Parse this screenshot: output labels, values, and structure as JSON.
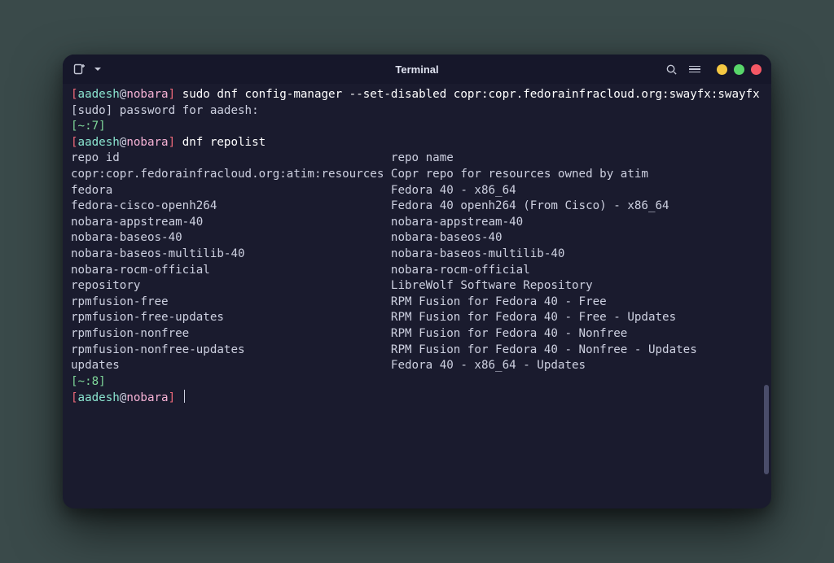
{
  "titlebar": {
    "title": "Terminal"
  },
  "prompt": {
    "user": "aadesh",
    "at": "@",
    "host": "nobara",
    "open": "[",
    "close": "]"
  },
  "lines": {
    "cmd1": "sudo dnf config-manager --set-disabled copr:copr.fedorainfracloud.org:swayfx:swayfx",
    "sudo": "[sudo] password for aadesh:",
    "t1": "[~:7]",
    "cmd2": "dnf repolist",
    "hdr": "repo id                                       repo name",
    "r1": "copr:copr.fedorainfracloud.org:atim:resources Copr repo for resources owned by atim",
    "r2": "fedora                                        Fedora 40 - x86_64",
    "r3": "fedora-cisco-openh264                         Fedora 40 openh264 (From Cisco) - x86_64",
    "r4": "nobara-appstream-40                           nobara-appstream-40",
    "r5": "nobara-baseos-40                              nobara-baseos-40",
    "r6": "nobara-baseos-multilib-40                     nobara-baseos-multilib-40",
    "r7": "nobara-rocm-official                          nobara-rocm-official",
    "r8": "repository                                    LibreWolf Software Repository",
    "r9": "rpmfusion-free                                RPM Fusion for Fedora 40 - Free",
    "r10": "rpmfusion-free-updates                        RPM Fusion for Fedora 40 - Free - Updates",
    "r11": "rpmfusion-nonfree                             RPM Fusion for Fedora 40 - Nonfree",
    "r12": "rpmfusion-nonfree-updates                     RPM Fusion for Fedora 40 - Nonfree - Updates",
    "r13": "updates                                       Fedora 40 - x86_64 - Updates",
    "t2": "[~:8]"
  }
}
